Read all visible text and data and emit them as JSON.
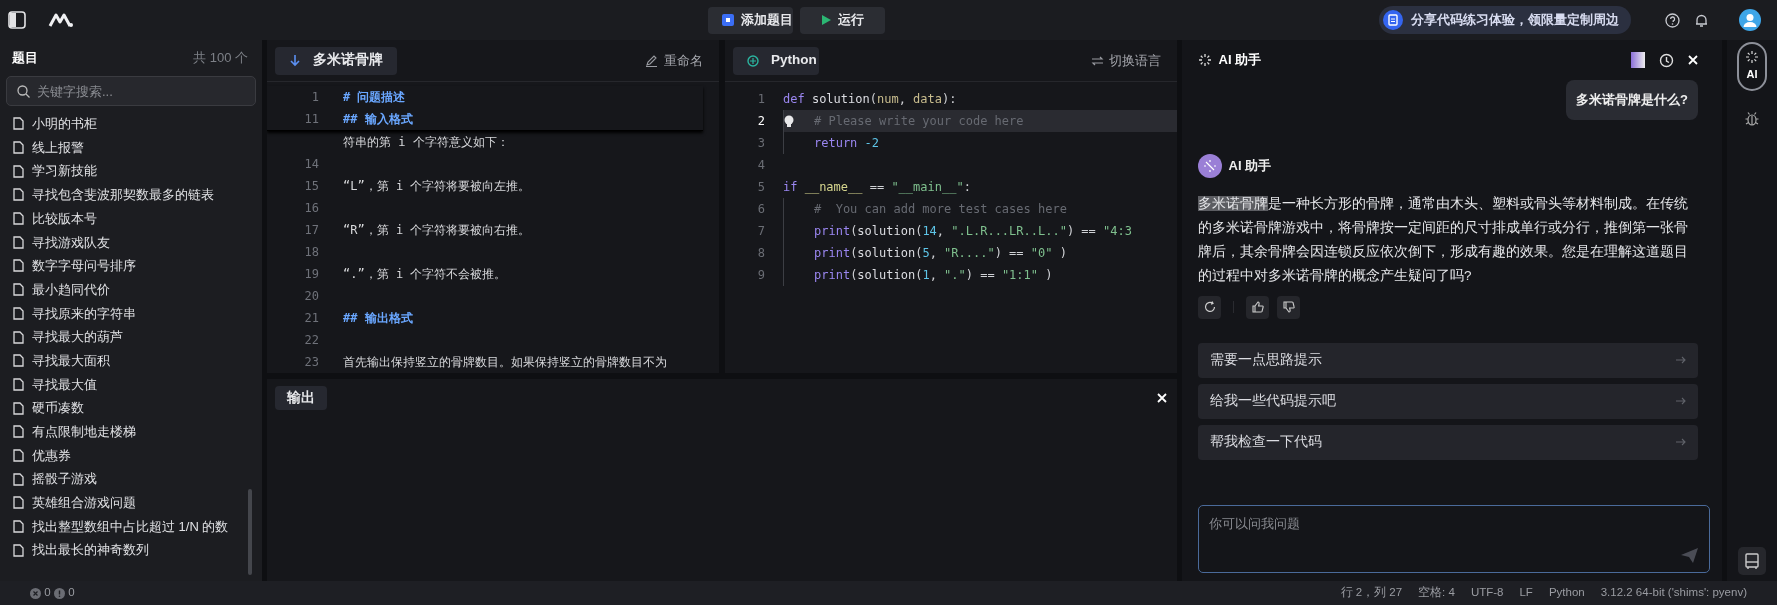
{
  "top_bar": {
    "buttons": [
      {
        "kind": "add",
        "label": "添加题目"
      },
      {
        "kind": "run",
        "label": "运行"
      }
    ],
    "promo": "分享代码练习体验，领限量定制周边"
  },
  "sidebar": {
    "title": "题目",
    "count": "共 100 个",
    "search": {
      "placeholder": "关键字搜索..."
    },
    "items": [
      "小明的书柜",
      "线上报警",
      "学习新技能",
      "寻找包含斐波那契数最多的链表",
      "比较版本号",
      "寻找游戏队友",
      "数字字母问号排序",
      "最小趋同代价",
      "寻找原来的字符串",
      "寻找最大的葫芦",
      "寻找最大面积",
      "寻找最大值",
      "硬币凑数",
      "有点限制地走楼梯",
      "优惠券",
      "摇骰子游戏",
      "英雄组合游戏问题",
      "找出整型数组中占比超过 1/N 的数",
      "找出最长的神奇数列"
    ]
  },
  "problem": {
    "tab": "多米诺骨牌",
    "rename": "重命名",
    "lines": [
      {
        "number": "1",
        "text": "# 问题描述",
        "kind": "heading",
        "sticky": true
      },
      {
        "number": "11",
        "text": "## 输入格式",
        "kind": "heading",
        "sticky": true
      },
      {
        "text": "符串的第 i 个字符意义如下：",
        "kind": "text",
        "sticky": false
      },
      {
        "number": "14",
        "sticky": false
      },
      {
        "number": "15",
        "text": "“L”，第 i 个字符将要被向左推。",
        "kind": "text",
        "sticky": false
      },
      {
        "number": "16",
        "sticky": false
      },
      {
        "number": "17",
        "text": "“R”，第 i 个字符将要被向右推。",
        "kind": "text",
        "sticky": false
      },
      {
        "number": "18",
        "sticky": false
      },
      {
        "number": "19",
        "text": "“.”，第 i 个字符不会被推。",
        "kind": "text",
        "sticky": false
      },
      {
        "number": "20",
        "sticky": false
      },
      {
        "number": "21",
        "text": "## 输出格式",
        "kind": "heading",
        "sticky": false
      },
      {
        "number": "22",
        "sticky": false
      },
      {
        "number": "23",
        "text": "首先输出保持竖立的骨牌数目。如果保持竖立的骨牌数目不为",
        "kind": "text",
        "sticky": false
      }
    ]
  },
  "code": {
    "language": "Python",
    "switch": "切换语言",
    "lines": [
      {
        "number": "1",
        "current": false,
        "indented": false,
        "tokens": [
          {
            "kind": "kw",
            "text": "def "
          },
          {
            "kind": "fn",
            "text": "solution"
          },
          {
            "kind": "p",
            "text": "("
          },
          {
            "kind": "param",
            "text": "num"
          },
          {
            "kind": "p",
            "text": ", "
          },
          {
            "kind": "param",
            "text": "data"
          },
          {
            "kind": "p",
            "text": "):"
          }
        ]
      },
      {
        "number": "2",
        "current": true,
        "indented": true,
        "tokens": [
          {
            "kind": "comment",
            "text": "# Please write your code here"
          }
        ]
      },
      {
        "number": "3",
        "current": false,
        "indented": true,
        "tokens": [
          {
            "kind": "kw",
            "text": "return "
          },
          {
            "kind": "num",
            "text": "-2"
          }
        ]
      },
      {
        "number": "4",
        "current": false,
        "indented": false
      },
      {
        "number": "5",
        "current": false,
        "indented": false,
        "tokens": [
          {
            "kind": "kw",
            "text": "if "
          },
          {
            "kind": "dunder",
            "text": "__name__"
          },
          {
            "kind": "p",
            "text": " == "
          },
          {
            "kind": "str",
            "text": "\"__main__\""
          },
          {
            "kind": "p",
            "text": ":"
          }
        ]
      },
      {
        "number": "6",
        "current": false,
        "indented": true,
        "tokens": [
          {
            "kind": "comment",
            "text": "#  You can add more test cases here"
          }
        ]
      },
      {
        "number": "7",
        "current": false,
        "indented": true,
        "tokens": [
          {
            "kind": "kw",
            "text": "print"
          },
          {
            "kind": "p",
            "text": "("
          },
          {
            "kind": "fn",
            "text": "solution"
          },
          {
            "kind": "p",
            "text": "("
          },
          {
            "kind": "num",
            "text": "14"
          },
          {
            "kind": "p",
            "text": ", "
          },
          {
            "kind": "str",
            "text": "\".L.R...LR..L..\""
          },
          {
            "kind": "p",
            "text": ") == "
          },
          {
            "kind": "str",
            "text": "\"4:3"
          }
        ]
      },
      {
        "number": "8",
        "current": false,
        "indented": true,
        "tokens": [
          {
            "kind": "kw",
            "text": "print"
          },
          {
            "kind": "p",
            "text": "("
          },
          {
            "kind": "fn",
            "text": "solution"
          },
          {
            "kind": "p",
            "text": "("
          },
          {
            "kind": "num",
            "text": "5"
          },
          {
            "kind": "p",
            "text": ", "
          },
          {
            "kind": "str",
            "text": "\"R....\""
          },
          {
            "kind": "p",
            "text": ") == "
          },
          {
            "kind": "str",
            "text": "\"0\""
          },
          {
            "kind": "p",
            "text": " )"
          }
        ]
      },
      {
        "number": "9",
        "current": false,
        "indented": true,
        "tokens": [
          {
            "kind": "kw",
            "text": "print"
          },
          {
            "kind": "p",
            "text": "("
          },
          {
            "kind": "fn",
            "text": "solution"
          },
          {
            "kind": "p",
            "text": "("
          },
          {
            "kind": "num",
            "text": "1"
          },
          {
            "kind": "p",
            "text": ", "
          },
          {
            "kind": "str",
            "text": "\".\""
          },
          {
            "kind": "p",
            "text": ") == "
          },
          {
            "kind": "str",
            "text": "\"1:1\""
          },
          {
            "kind": "p",
            "text": " )"
          }
        ]
      }
    ]
  },
  "output": {
    "tab": "输出"
  },
  "assistant": {
    "title": "AI 助手",
    "question": "多米诺骨牌是什么?",
    "bot_name": "AI 助手",
    "selected_text": "多米诺骨牌",
    "answer": "是一种长方形的骨牌，通常由木头、塑料或骨头等材料制成。在传统的多米诺骨牌游戏中，将骨牌按一定间距的尺寸排成单行或分行，推倒第一张骨牌后，其余骨牌会因连锁反应依次倒下，形成有趣的效果。您是在理解这道题目的过程中对多米诺骨牌的概念产生疑问了吗?",
    "suggestions": [
      "需要一点思路提示",
      "给我一些代码提示吧",
      "帮我检查一下代码"
    ],
    "input": {
      "placeholder": "你可以问我问题"
    }
  },
  "rail": [
    {
      "kind": "ai",
      "label": "AI",
      "selected": true
    },
    {
      "kind": "debug",
      "selected": false
    }
  ],
  "status_bar": {
    "errors": "0",
    "warnings": "0",
    "items": [
      "行 2，列 27",
      "空格: 4",
      "UTF-8",
      "LF",
      "Python",
      "3.12.2 64-bit ('shims': pyenv)"
    ]
  }
}
